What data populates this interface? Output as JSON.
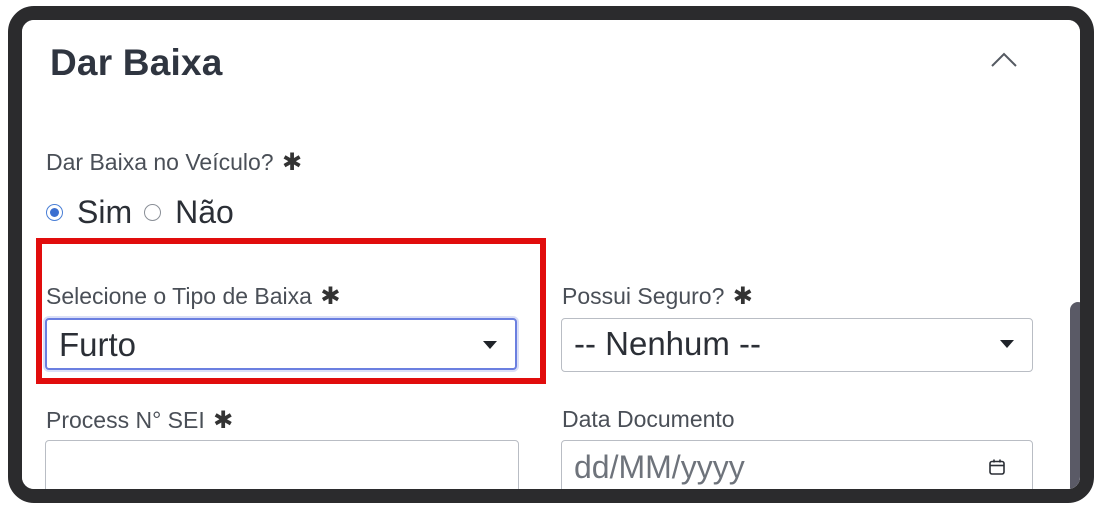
{
  "section": {
    "title": "Dar Baixa"
  },
  "baixa_veiculo": {
    "label": "Dar Baixa no Veículo?",
    "required_mark": "✱",
    "options": [
      {
        "label": "Sim",
        "checked": true
      },
      {
        "label": "Não",
        "checked": false
      }
    ]
  },
  "tipo_baixa": {
    "label": "Selecione o Tipo de Baixa",
    "required_mark": "✱",
    "value": "Furto"
  },
  "possui_seguro": {
    "label": "Possui Seguro?",
    "required_mark": "✱",
    "value": "-- Nenhum --"
  },
  "processo_sei": {
    "label": "Process N° SEI",
    "required_mark": "✱",
    "value": ""
  },
  "data_documento": {
    "label": "Data Documento",
    "placeholder": "dd/MM/yyyy"
  },
  "colors": {
    "highlight": "#e10d0d",
    "focus_border": "#6b7fe0",
    "radio_accent": "#3b6fd0"
  },
  "icons": {
    "collapse": "chevron-up-icon",
    "select_caret": "caret-down-icon",
    "calendar": "calendar-icon"
  }
}
